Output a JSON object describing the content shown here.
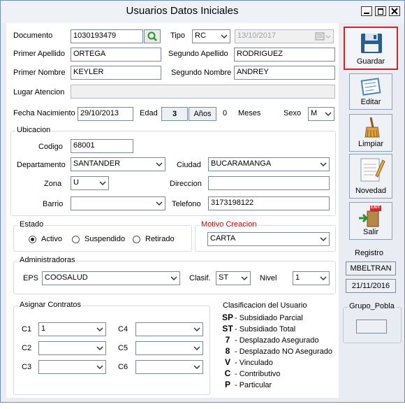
{
  "window": {
    "title": "Usuarios Datos Iniciales"
  },
  "fields": {
    "documento_label": "Documento",
    "documento_value": "1030193479",
    "tipo_label": "Tipo",
    "tipo_value": "RC",
    "date_value": "13/10/2017",
    "primer_apellido_label": "Primer Apellido",
    "primer_apellido_value": "ORTEGA",
    "segundo_apellido_label": "Segundo Apellido",
    "segundo_apellido_value": "RODRIGUEZ",
    "primer_nombre_label": "Primer Nombre",
    "primer_nombre_value": "KEYLER",
    "segundo_nombre_label": "Segundo Nombre",
    "segundo_nombre_value": "ANDREY",
    "lugar_label": "Lugar Atencion",
    "lugar_value": "",
    "fecha_nac_label": "Fecha Nacimiento",
    "fecha_nac_value": "29/10/2013",
    "edad_label": "Edad",
    "edad_value": "3",
    "anos_label": "Años",
    "meses_value": "0",
    "meses_label": "Meses",
    "sexo_label": "Sexo",
    "sexo_value": "M"
  },
  "ubicacion": {
    "title": "Ubicacion",
    "codigo_label": "Codigo",
    "codigo_value": "68001",
    "departamento_label": "Departamento",
    "departamento_value": "SANTANDER",
    "ciudad_label": "Ciudad",
    "ciudad_value": "BUCARAMANGA",
    "zona_label": "Zona",
    "zona_value": "U",
    "direccion_label": "Direccion",
    "direccion_value": "",
    "barrio_label": "Barrio",
    "barrio_value": "",
    "telefono_label": "Telefono",
    "telefono_value": "3173198122"
  },
  "estado": {
    "title": "Estado",
    "options": [
      "Activo",
      "Suspendido",
      "Retirado"
    ],
    "selected": "Activo"
  },
  "motivo": {
    "title": "Motivo Creacion",
    "value": "CARTA",
    "title_color": "#cc0000"
  },
  "administradoras": {
    "title": "Administradoras",
    "eps_label": "EPS",
    "eps_value": "COOSALUD",
    "clasif_label": "Clasif.",
    "clasif_value": "ST",
    "nivel_label": "Nivel",
    "nivel_value": "1"
  },
  "contratos": {
    "title": "Asignar Contratos",
    "c1_label": "C1",
    "c1_value": "1",
    "c2_label": "C2",
    "c2_value": "",
    "c3_label": "C3",
    "c3_value": "",
    "c4_label": "C4",
    "c4_value": "",
    "c5_label": "C5",
    "c5_value": "",
    "c6_label": "C6",
    "c6_value": ""
  },
  "clasificacion": {
    "title": "Clasificacion del Usuario",
    "items": [
      {
        "code": "SP",
        "desc": "- Subsidiado Parcial"
      },
      {
        "code": "ST",
        "desc": "- Subsidiado Total"
      },
      {
        "code": "7",
        "desc": "- Desplazado Asegurado"
      },
      {
        "code": "8",
        "desc": "- Desplazado NO Asegurado"
      },
      {
        "code": "V",
        "desc": "- Vinculado"
      },
      {
        "code": "C",
        "desc": "- Contributivo"
      },
      {
        "code": "P",
        "desc": "- Particular"
      }
    ]
  },
  "sidebar": {
    "guardar": "Guardar",
    "editar": "Editar",
    "limpiar": "Limpiar",
    "novedad": "Novedad",
    "salir": "Salir",
    "salir_badge": "EXIT",
    "highlight_color": "#e02020"
  },
  "registro": {
    "title": "Registro",
    "user": "MBELTRAN",
    "date": "21/11/2016"
  },
  "grupo": {
    "title": "Grupo_Pobla",
    "value": ""
  },
  "icons": [
    "search-icon",
    "calendar-icon",
    "chevron-down-icon",
    "save-icon",
    "edit-icon",
    "broom-icon",
    "notepad-icon",
    "exit-door-icon",
    "minimize-icon",
    "maximize-icon",
    "close-icon"
  ]
}
